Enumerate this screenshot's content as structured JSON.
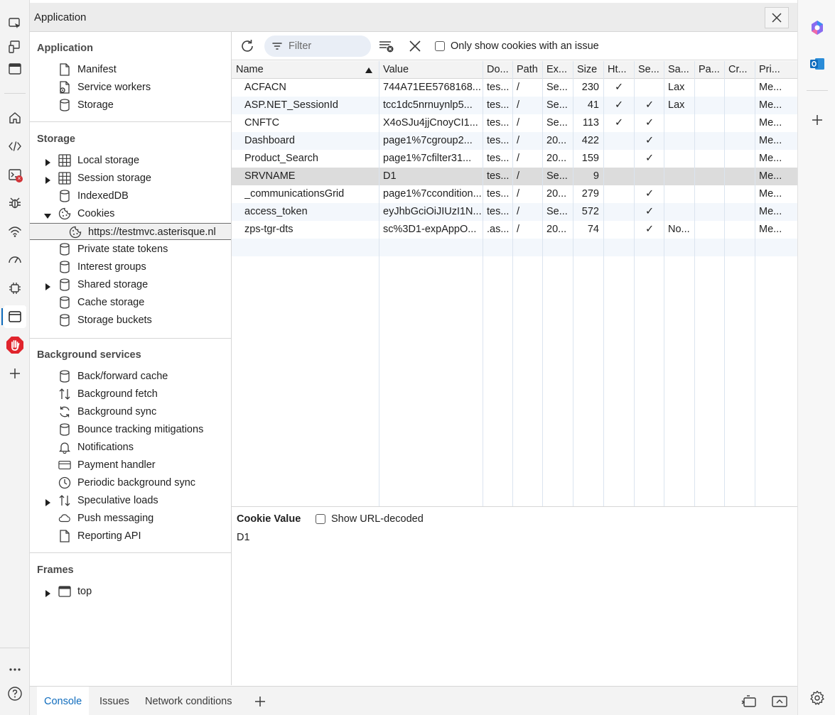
{
  "window": {
    "title": "Application"
  },
  "activity_bar": {
    "items": [
      "inspect-icon",
      "device-emulation-icon",
      "panel-icon",
      "welcome-icon",
      "elements-icon",
      "console-icon",
      "sources-icon",
      "network-icon",
      "performance-icon",
      "memory-icon",
      "application-icon",
      "adblock-icon",
      "add-icon",
      "more-icon",
      "help-icon"
    ],
    "console_badge": "×"
  },
  "sidebar": {
    "sections": [
      {
        "title": "Application",
        "items": [
          "Manifest",
          "Service workers",
          "Storage"
        ]
      },
      {
        "title": "Storage",
        "items": [
          "Local storage",
          "Session storage",
          "IndexedDB",
          "Cookies",
          "https://testmvc.asterisque.nl",
          "Private state tokens",
          "Interest groups",
          "Shared storage",
          "Cache storage",
          "Storage buckets"
        ]
      },
      {
        "title": "Background services",
        "items": [
          "Back/forward cache",
          "Background fetch",
          "Background sync",
          "Bounce tracking mitigations",
          "Notifications",
          "Payment handler",
          "Periodic background sync",
          "Speculative loads",
          "Push messaging",
          "Reporting API"
        ]
      },
      {
        "title": "Frames",
        "items": [
          "top"
        ]
      }
    ]
  },
  "toolbar": {
    "filter_placeholder": "Filter",
    "only_issues_label": "Only show cookies with an issue"
  },
  "table": {
    "columns": [
      "Name",
      "Value",
      "Do...",
      "Path",
      "Ex...",
      "Size",
      "Ht...",
      "Se...",
      "Sa...",
      "Pa...",
      "Cr...",
      "Pri..."
    ],
    "rows": [
      [
        "ACFACN",
        "744A71EE5768168...",
        "tes...",
        "/",
        "Se...",
        "230",
        "✓",
        "",
        "Lax",
        "",
        "",
        "Me..."
      ],
      [
        "ASP.NET_SessionId",
        "tcc1dc5nrnuynlp5...",
        "tes...",
        "/",
        "Se...",
        "41",
        "✓",
        "✓",
        "Lax",
        "",
        "",
        "Me..."
      ],
      [
        "CNFTC",
        "X4oSJu4jjCnoyCI1...",
        "tes...",
        "/",
        "Se...",
        "113",
        "✓",
        "✓",
        "",
        "",
        "",
        "Me..."
      ],
      [
        "Dashboard",
        "page1%7cgroup2...",
        "tes...",
        "/",
        "20...",
        "422",
        "",
        "✓",
        "",
        "",
        "",
        "Me..."
      ],
      [
        "Product_Search",
        "page1%7cfilter31...",
        "tes...",
        "/",
        "20...",
        "159",
        "",
        "✓",
        "",
        "",
        "",
        "Me..."
      ],
      [
        "SRVNAME",
        "D1",
        "tes...",
        "/",
        "Se...",
        "9",
        "",
        "",
        "",
        "",
        "",
        "Me..."
      ],
      [
        "_communicationsGrid",
        "page1%7ccondition...",
        "tes...",
        "/",
        "20...",
        "279",
        "",
        "✓",
        "",
        "",
        "",
        "Me..."
      ],
      [
        "access_token",
        "eyJhbGciOiJIUzI1N...",
        "tes...",
        "/",
        "Se...",
        "572",
        "",
        "✓",
        "",
        "",
        "",
        "Me..."
      ],
      [
        "zps-tgr-dts",
        "sc%3D1-expAppO...",
        ".as...",
        "/",
        "20...",
        "74",
        "",
        "✓",
        "No...",
        "",
        "",
        "Me..."
      ]
    ]
  },
  "detail": {
    "title": "Cookie Value",
    "decode_label": "Show URL-decoded",
    "value": "D1"
  },
  "drawer": {
    "tabs": [
      "Console",
      "Issues",
      "Network conditions"
    ]
  }
}
